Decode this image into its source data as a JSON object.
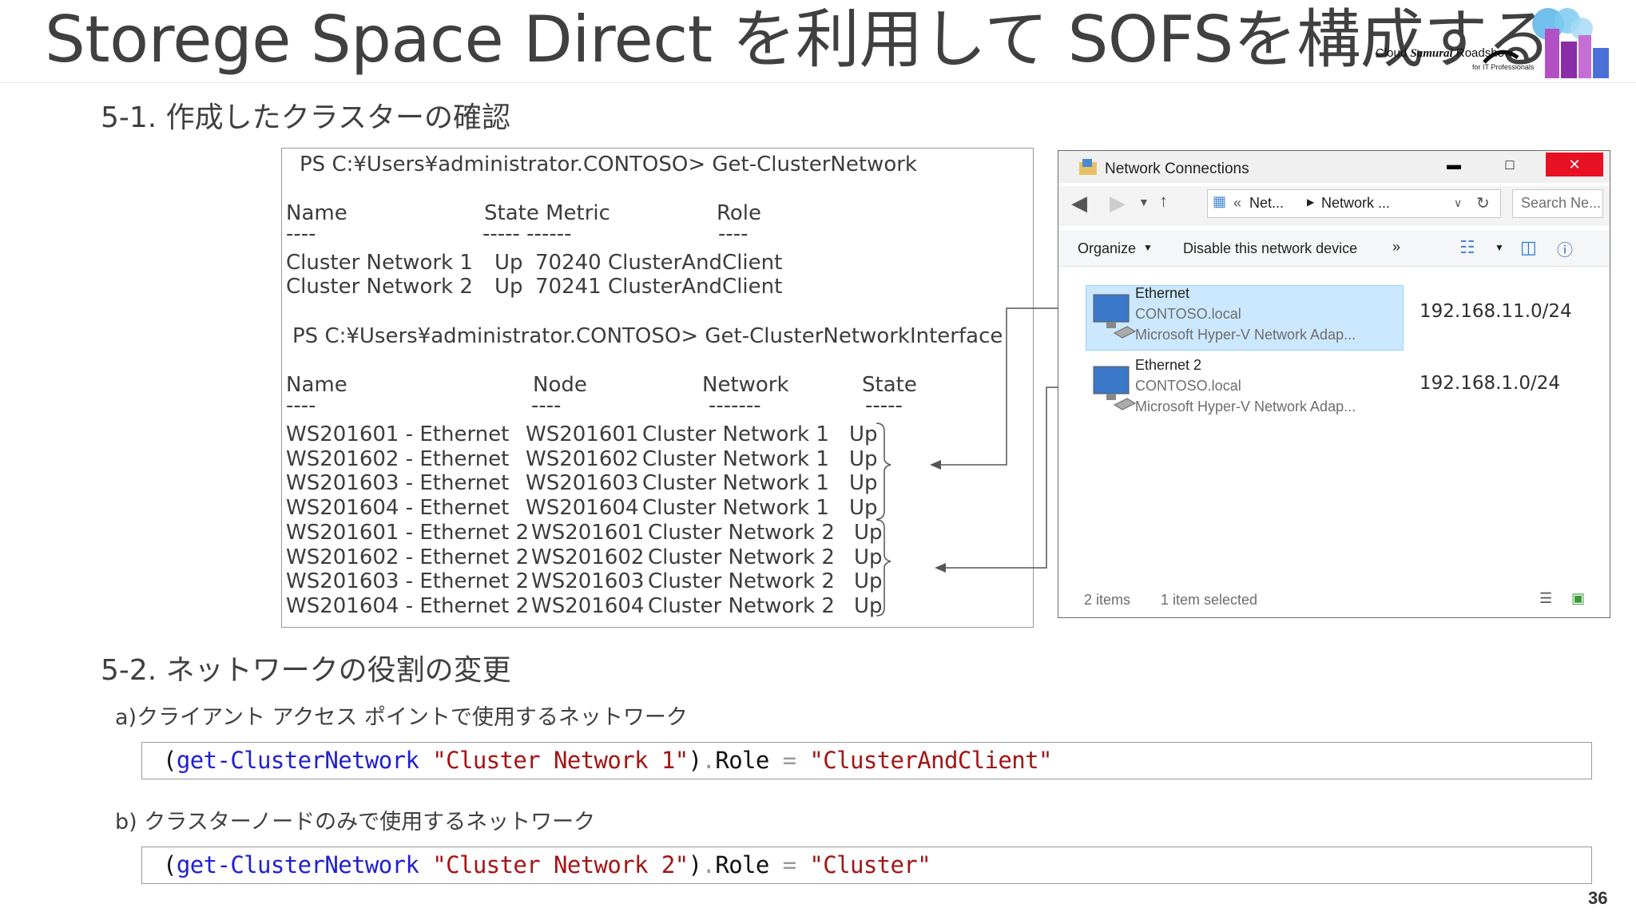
{
  "slide": {
    "title": "Storege Space Direct を利用して SOFSを構成する",
    "page_number": "36",
    "logo": {
      "text_prefix": "Cloud ",
      "text_brand": "Samurai",
      "text_suffix": " Roadshow",
      "subtext": "for IT Professionals"
    }
  },
  "section1": {
    "heading": "5-1. 作成したクラスターの確認",
    "ps_output": {
      "cmd1": "PS C:¥Users¥administrator.CONTOSO> Get-ClusterNetwork",
      "cmd1_headers": [
        "Name",
        "State Metric",
        "Role"
      ],
      "cmd1_dashes": [
        "----",
        "----- ------",
        "----"
      ],
      "cmd1_rows": [
        [
          "Cluster Network 1",
          "Up",
          "70240",
          "ClusterAndClient"
        ],
        [
          "Cluster Network 2",
          "Up",
          "70241",
          "ClusterAndClient"
        ]
      ],
      "cmd2": "PS C:¥Users¥administrator.CONTOSO> Get-ClusterNetworkInterface",
      "cmd2_headers": [
        "Name",
        "Node",
        "Network",
        "State"
      ],
      "cmd2_dashes": [
        "----",
        "----",
        "-------",
        "-----"
      ],
      "cmd2_rows": [
        [
          "WS201601 - Ethernet",
          "WS201601",
          "Cluster Network 1",
          "Up"
        ],
        [
          "WS201602 - Ethernet",
          "WS201602",
          "Cluster Network 1",
          "Up"
        ],
        [
          "WS201603 - Ethernet",
          "WS201603",
          "Cluster Network 1",
          "Up"
        ],
        [
          "WS201604 - Ethernet",
          "WS201604",
          "Cluster Network 1",
          "Up"
        ],
        [
          "WS201601 - Ethernet 2",
          "WS201601",
          "Cluster Network 2",
          "Up"
        ],
        [
          "WS201602 - Ethernet 2",
          "WS201602",
          "Cluster Network 2",
          "Up"
        ],
        [
          "WS201603 - Ethernet 2",
          "WS201603",
          "Cluster Network 2",
          "Up"
        ],
        [
          "WS201604 - Ethernet 2",
          "WS201604",
          "Cluster Network 2",
          "Up"
        ]
      ]
    }
  },
  "network_window": {
    "title": "Network Connections",
    "breadcrumb": [
      "Net...",
      "Network ..."
    ],
    "search_placeholder": "Search Ne...",
    "toolbar": {
      "organize": "Organize",
      "disable": "Disable this network device",
      "more": "»"
    },
    "items": [
      {
        "name": "Ethernet",
        "domain": "CONTOSO.local",
        "device": "Microsoft Hyper-V Network Adap...",
        "ip": "192.168.11.0/24",
        "selected": true
      },
      {
        "name": "Ethernet 2",
        "domain": "CONTOSO.local",
        "device": "Microsoft Hyper-V Network Adap...",
        "ip": "192.168.1.0/24",
        "selected": false
      }
    ],
    "status": {
      "count": "2 items",
      "selection": "1 item selected"
    }
  },
  "section2": {
    "heading": "5-2. ネットワークの役割の変更",
    "a": {
      "label": "a)クライアント アクセス ポイントで使用するネットワーク",
      "code": {
        "fn": "get-ClusterNetwork",
        "arg": "\"Cluster Network 1\"",
        "prop": "Role",
        "value": "\"ClusterAndClient\""
      }
    },
    "b": {
      "label": "b) クラスターノードのみで使用するネットワーク",
      "code": {
        "fn": "get-ClusterNetwork",
        "arg": "\"Cluster Network 2\"",
        "prop": "Role",
        "value": "\"Cluster\""
      }
    }
  },
  "colors": {
    "code_function": "#1f1fd0",
    "code_string": "#a31515",
    "selection": "#cce8ff",
    "close_button": "#e81123"
  }
}
